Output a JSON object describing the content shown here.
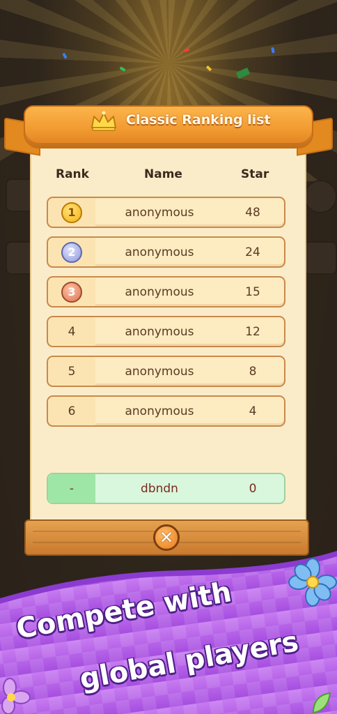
{
  "title": "Classic Ranking list",
  "columns": {
    "rank": "Rank",
    "name": "Name",
    "star": "Star"
  },
  "rows": [
    {
      "rank": "1",
      "medal": "gold",
      "name": "anonymous",
      "star": "48"
    },
    {
      "rank": "2",
      "medal": "silver",
      "name": "anonymous",
      "star": "24"
    },
    {
      "rank": "3",
      "medal": "bronze",
      "name": "anonymous",
      "star": "15"
    },
    {
      "rank": "4",
      "name": "anonymous",
      "star": "12"
    },
    {
      "rank": "5",
      "name": "anonymous",
      "star": "8"
    },
    {
      "rank": "6",
      "name": "anonymous",
      "star": "4"
    }
  ],
  "current_player": {
    "rank": "-",
    "name": "dbndn",
    "star": "0"
  },
  "close_icon": "close-x-icon",
  "promo": {
    "line1": "Compete with",
    "line2": "global players"
  },
  "colors": {
    "ribbon": "#f09830",
    "panel": "#fbecc9",
    "row_border": "#c8894a",
    "mine_bg": "#d9f7dd",
    "promo_purple": "#b45ae6"
  }
}
